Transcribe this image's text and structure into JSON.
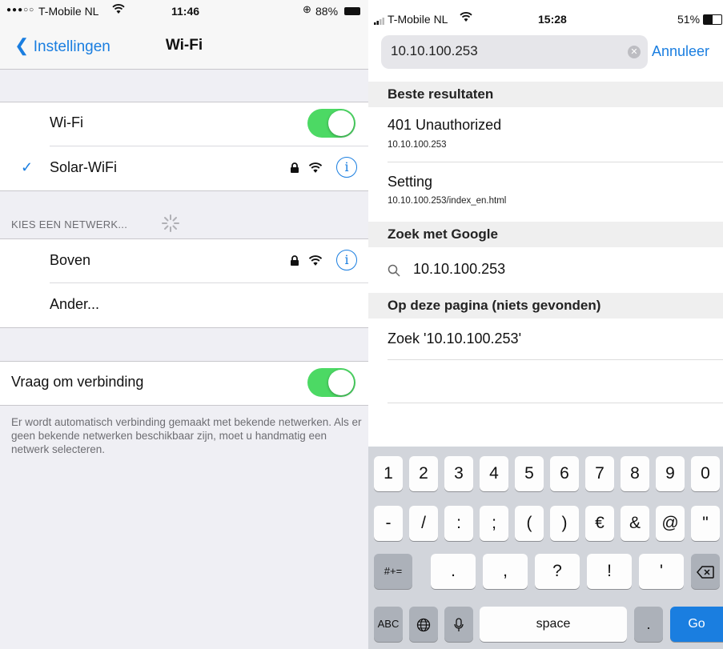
{
  "left": {
    "status": {
      "signal": "●●●○○",
      "carrier": "T-Mobile NL",
      "wifi_icon": "wifi-icon",
      "time": "11:46",
      "battery_pct": "88%"
    },
    "nav": {
      "back_label": "Instellingen",
      "title": "Wi-Fi"
    },
    "wifi_row": {
      "label": "Wi-Fi",
      "enabled": true
    },
    "connected": {
      "checkmark": "✓",
      "name": "Solar-WiFi"
    },
    "choose_header": "KIES EEN NETWERK...",
    "networks": [
      {
        "name": "Boven"
      }
    ],
    "other_label": "Ander...",
    "ask_row": {
      "label": "Vraag om verbinding",
      "enabled": true
    },
    "ask_footer": "Er wordt automatisch verbinding gemaakt met bekende netwerken. Als er geen bekende netwerken beschikbaar zijn, moet u handmatig een netwerk selecteren."
  },
  "right": {
    "status": {
      "carrier": "T-Mobile NL",
      "time": "15:28",
      "battery_pct": "51%"
    },
    "search": {
      "value": "10.10.100.253",
      "cancel_label": "Annuleer"
    },
    "top_results_header": "Beste resultaten",
    "results": [
      {
        "title": "401 Unauthorized",
        "url": "10.10.100.253"
      },
      {
        "title": "Setting",
        "url": "10.10.100.253/index_en.html"
      }
    ],
    "google_header": "Zoek met Google",
    "google_query": "10.10.100.253",
    "page_header": "Op deze pagina (niets gevonden)",
    "page_search": "Zoek '10.10.100.253'",
    "keyboard": {
      "row1": [
        "1",
        "2",
        "3",
        "4",
        "5",
        "6",
        "7",
        "8",
        "9",
        "0"
      ],
      "row2": [
        "-",
        "/",
        ":",
        ";",
        "(",
        ")",
        "€",
        "&",
        "@",
        "\""
      ],
      "row3_left": "#+=",
      "row3": [
        ".",
        ",",
        "?",
        "!",
        "'"
      ],
      "abc": "ABC",
      "space": "space",
      "dot": ".",
      "go": "Go"
    }
  },
  "colors": {
    "accent": "#1a7ee0",
    "toggle_on": "#4cd964",
    "group_bg": "#efeff4",
    "keyboard_bg": "#d2d5db"
  }
}
